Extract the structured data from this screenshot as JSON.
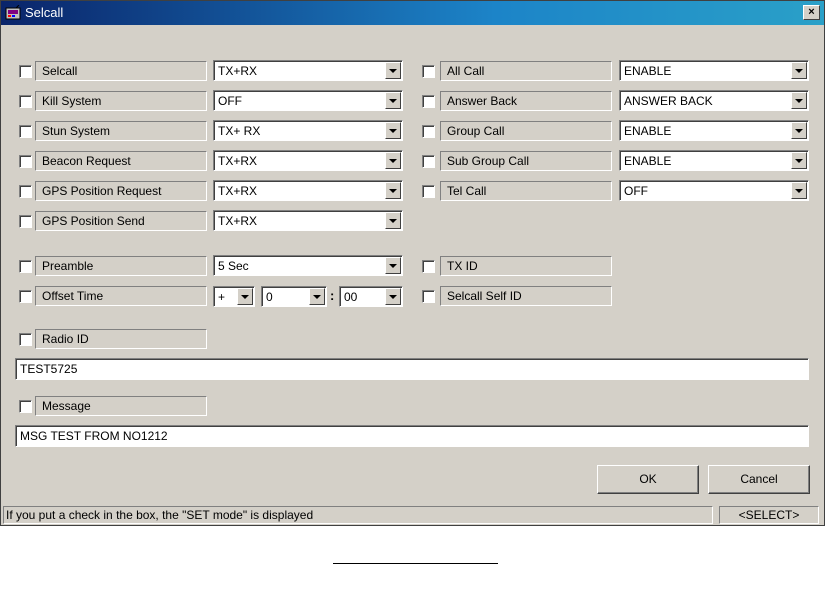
{
  "window": {
    "title": "Selcall",
    "close_label": "×",
    "app_icon": "radio-app-icon"
  },
  "left_rows": [
    {
      "label": "Selcall",
      "value": "TX+RX"
    },
    {
      "label": "Kill System",
      "value": "OFF"
    },
    {
      "label": "Stun System",
      "value": "TX+ RX"
    },
    {
      "label": "Beacon Request",
      "value": "TX+RX"
    },
    {
      "label": "GPS Position Request",
      "value": "TX+RX"
    },
    {
      "label": "GPS Position Send",
      "value": "TX+RX"
    }
  ],
  "right_rows": [
    {
      "label": "All Call",
      "value": "ENABLE"
    },
    {
      "label": "Answer Back",
      "value": "ANSWER BACK"
    },
    {
      "label": "Group Call",
      "value": "ENABLE"
    },
    {
      "label": "Sub Group Call",
      "value": "ENABLE"
    },
    {
      "label": "Tel Call",
      "value": "OFF"
    }
  ],
  "preamble": {
    "label": "Preamble",
    "value": "5 Sec"
  },
  "offset_time": {
    "label": "Offset Time",
    "sign": "+",
    "hours": "0",
    "separator": ":",
    "minutes": "00"
  },
  "tx_id": {
    "label": "TX ID"
  },
  "selcall_self_id": {
    "label": "Selcall Self ID"
  },
  "radio_id": {
    "label": "Radio ID",
    "value": "TEST5725"
  },
  "message": {
    "label": "Message",
    "value": "MSG TEST FROM NO1212"
  },
  "buttons": {
    "ok": "OK",
    "cancel": "Cancel"
  },
  "status_bar": {
    "hint": "If you put a check in the box, the \"SET mode\" is displayed",
    "mode": "<SELECT>"
  }
}
